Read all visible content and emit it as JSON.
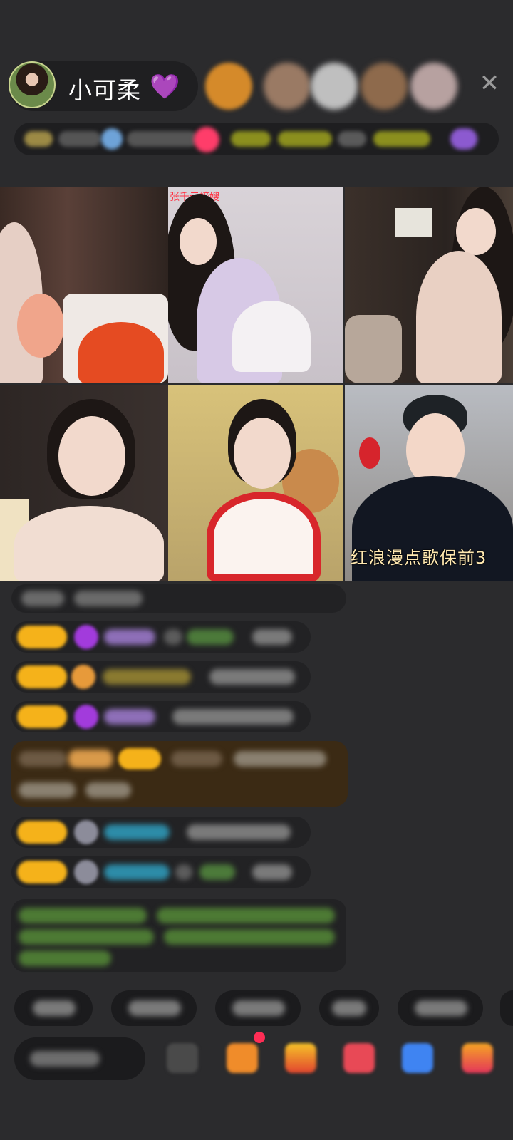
{
  "header": {
    "host_name": "小可柔",
    "host_emoji": "💜",
    "viewer_count": 5
  },
  "grid": {
    "tile_top_tag": "张千元榜嫂",
    "tile_caption": "红浪漫点歌保前3"
  },
  "colors": {
    "background": "#2b2b2d",
    "badge": "#f5b21a",
    "accent_heart": "#a84bff",
    "highlight_message_bg": "#3b2a14"
  },
  "icons": {
    "close": "close-icon",
    "heart": "heart-icon"
  }
}
